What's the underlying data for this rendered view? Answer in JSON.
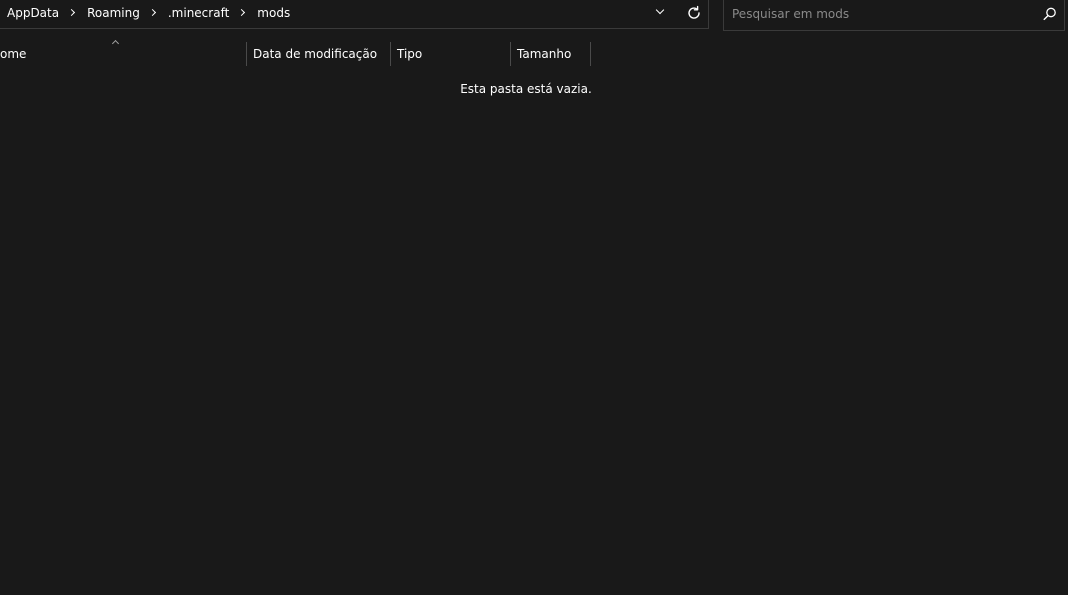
{
  "address_bar": {
    "breadcrumb": [
      "AppData",
      "Roaming",
      ".minecraft",
      "mods"
    ]
  },
  "search": {
    "placeholder": "Pesquisar em mods",
    "value": ""
  },
  "columns": [
    {
      "label": "ome"
    },
    {
      "label": "Data de modificação"
    },
    {
      "label": "Tipo"
    },
    {
      "label": "Tamanho"
    }
  ],
  "content": {
    "empty_message": "Esta pasta está vazia."
  },
  "icons": {
    "dropdown": "chevron-down-icon",
    "refresh": "refresh-icon",
    "search": "search-icon",
    "separator": "chevron-right-icon",
    "sort": "sort-ascending-icon"
  },
  "colors": {
    "background": "#191919",
    "text": "#ffffff",
    "placeholder": "#8a8a8a",
    "border": "#3a3a3a"
  }
}
